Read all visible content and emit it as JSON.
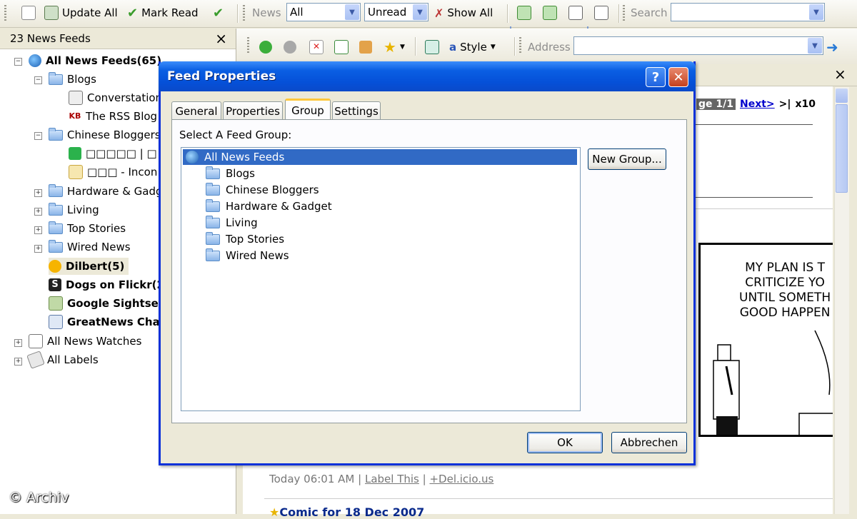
{
  "toolbar": {
    "update_all": "Update All",
    "mark_read": "Mark Read",
    "news_label": "News",
    "news_filter": "All",
    "unread_filter": "Unread",
    "show_all": "Show All",
    "search_label": "Search",
    "search_value": ""
  },
  "sidebar": {
    "header": "23 News Feeds",
    "close": "×",
    "items": [
      {
        "label": "All News Feeds(65)"
      },
      {
        "label": "Blogs"
      },
      {
        "label": "Converstation"
      },
      {
        "label": "The RSS Blog"
      },
      {
        "label": "Chinese Bloggers"
      },
      {
        "label": "□□□□□ | □"
      },
      {
        "label": "□□□ - Incon"
      },
      {
        "label": "Hardware & Gadg"
      },
      {
        "label": "Living"
      },
      {
        "label": "Top Stories"
      },
      {
        "label": "Wired News"
      },
      {
        "label": "Dilbert(5)"
      },
      {
        "label": "Dogs on Flickr(2"
      },
      {
        "label": "Google Sightse"
      },
      {
        "label": "GreatNews Cha"
      },
      {
        "label": "All News Watches"
      },
      {
        "label": "All Labels"
      }
    ]
  },
  "browser": {
    "style_label": "Style",
    "address_label": "Address",
    "address_value": "",
    "close": "×"
  },
  "content": {
    "page_info": "ge 1/1",
    "next_link": "Next>",
    "last_link": ">|",
    "per_page": "x10",
    "comic_lines": [
      "MY PLAN IS T",
      "CRITICIZE YO",
      "UNTIL SOMETH",
      "GOOD HAPPEN"
    ],
    "meta_time": "Today 06:01 AM",
    "label_this": "Label This",
    "delicious": "+Del.icio.us",
    "next_item_title": "Comic for 18 Dec 2007",
    "watermark": "© Archiv"
  },
  "dialog": {
    "title": "Feed Properties",
    "help": "?",
    "close": "✕",
    "tabs": [
      {
        "label": "General"
      },
      {
        "label": "Properties"
      },
      {
        "label": "Group"
      },
      {
        "label": "Settings"
      }
    ],
    "select_label": "Select A Feed Group:",
    "groups": [
      {
        "label": "All News Feeds"
      },
      {
        "label": "Blogs"
      },
      {
        "label": "Chinese Bloggers"
      },
      {
        "label": "Hardware & Gadget"
      },
      {
        "label": "Living"
      },
      {
        "label": "Top Stories"
      },
      {
        "label": "Wired News"
      }
    ],
    "selected_group": "All News Feeds",
    "new_group_button": "New Group...",
    "ok_button": "OK",
    "cancel_button": "Abbrechen"
  },
  "colors": {
    "accent": "#316ac5",
    "title_blue": "#0550d8",
    "link_blue": "#0000cc"
  }
}
